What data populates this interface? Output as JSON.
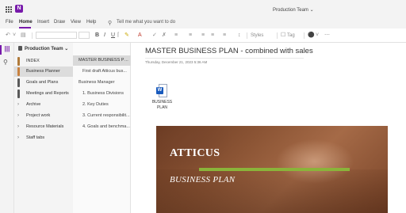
{
  "titlebar": {
    "app_title": "Production Team ⌄"
  },
  "menu": {
    "tabs": [
      "File",
      "Home",
      "Insert",
      "Draw",
      "View",
      "Help"
    ],
    "tellme": "Tell me what you want to do"
  },
  "ribbon": {
    "styles": "Styles",
    "tag": "Tag"
  },
  "notebook": {
    "name": "Production Team ⌄"
  },
  "sections": [
    {
      "label": "INDEX",
      "color": "#b07a3a"
    },
    {
      "label": "Business Planner",
      "color": "#c8813f"
    },
    {
      "label": "Goals and Plans",
      "color": "#5a5a5a"
    },
    {
      "label": "Meetings and Reports",
      "color": "#5a5a5a"
    },
    {
      "label": "Archive"
    },
    {
      "label": "Project work"
    },
    {
      "label": "Resource Materials"
    },
    {
      "label": "Staff tabs"
    }
  ],
  "pages": [
    {
      "label": "MASTER BUSINESS PLA..."
    },
    {
      "label": "First draft Atticus bus..."
    },
    {
      "label": "Business Manager"
    },
    {
      "label": "1. Business Divisions"
    },
    {
      "label": "2. Key Duties"
    },
    {
      "label": "3. Current responsibilit..."
    },
    {
      "label": "4. Goals and benchma..."
    }
  ],
  "canvas": {
    "title": "MASTER BUSINESS PLAN - combined with sales",
    "date": "Thursday, December 21, 2023     5:36 AM",
    "file_label": "BUSINESS PLAN",
    "file_icon": "W",
    "cover_name": "ATTICUS",
    "cover_subtitle": "BUSINESS PLAN"
  },
  "colors": {
    "accent": "#7719aa",
    "word": "#185abd",
    "cover_bar": "#8ab43a"
  }
}
